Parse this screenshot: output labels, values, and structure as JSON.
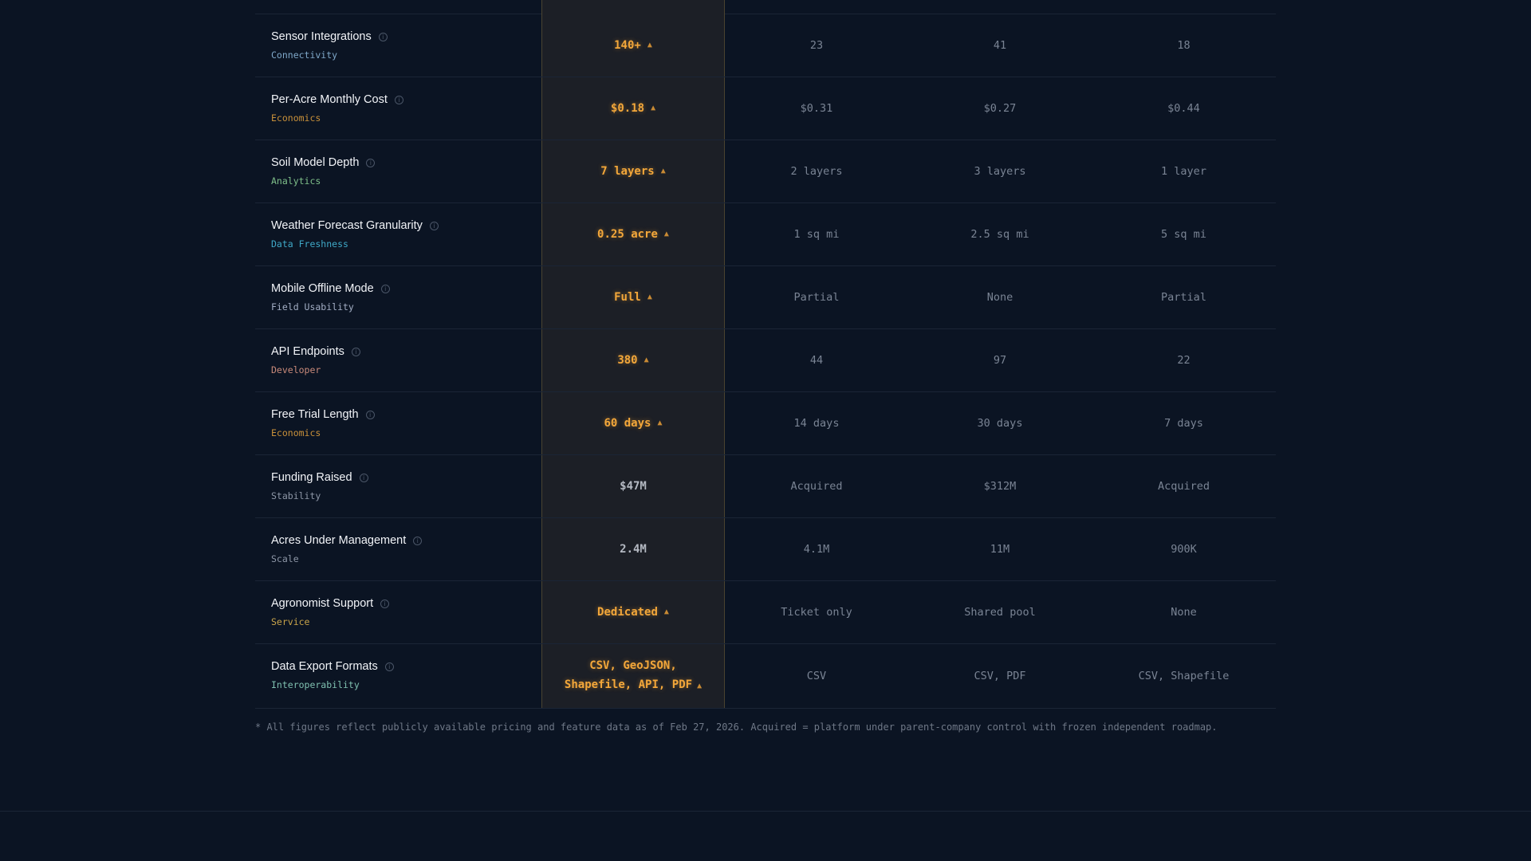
{
  "colors": {
    "background": "#0b1423",
    "highlight_value": "#f3a73a",
    "highlight_column_bg": "#1c1f26",
    "highlight_border": "#4a4330",
    "competitor_text": "#7a8494"
  },
  "rows": [
    {
      "feature": "Sensor Integrations",
      "category": "Connectivity",
      "category_color": "#7fa8c9",
      "highlight": "140+",
      "win": true,
      "c1": "23",
      "c2": "41",
      "c3": "18"
    },
    {
      "feature": "Per-Acre Monthly Cost",
      "category": "Economics",
      "category_color": "#c8903a",
      "highlight": "$0.18",
      "win": true,
      "c1": "$0.31",
      "c2": "$0.27",
      "c3": "$0.44"
    },
    {
      "feature": "Soil Model Depth",
      "category": "Analytics",
      "category_color": "#7fc08a",
      "highlight": "7 layers",
      "win": true,
      "c1": "2 layers",
      "c2": "3 layers",
      "c3": "1 layer"
    },
    {
      "feature": "Weather Forecast Granularity",
      "category": "Data Freshness",
      "category_color": "#3fa9c8",
      "highlight": "0.25 acre",
      "win": true,
      "c1": "1 sq mi",
      "c2": "2.5 sq mi",
      "c3": "5 sq mi"
    },
    {
      "feature": "Mobile Offline Mode",
      "category": "Field Usability",
      "category_color": "#a3aec4",
      "highlight": "Full",
      "win": true,
      "c1": "Partial",
      "c2": "None",
      "c3": "Partial"
    },
    {
      "feature": "API Endpoints",
      "category": "Developer",
      "category_color": "#c98a7a",
      "highlight": "380",
      "win": true,
      "c1": "44",
      "c2": "97",
      "c3": "22"
    },
    {
      "feature": "Free Trial Length",
      "category": "Economics",
      "category_color": "#c8903a",
      "highlight": "60 days",
      "win": true,
      "c1": "14 days",
      "c2": "30 days",
      "c3": "7 days"
    },
    {
      "feature": "Funding Raised",
      "category": "Stability",
      "category_color": "#8d96a6",
      "highlight": "$47M",
      "win": false,
      "c1": "Acquired",
      "c2": "$312M",
      "c3": "Acquired"
    },
    {
      "feature": "Acres Under Management",
      "category": "Scale",
      "category_color": "#8d96a6",
      "highlight": "2.4M",
      "win": false,
      "c1": "4.1M",
      "c2": "11M",
      "c3": "900K"
    },
    {
      "feature": "Agronomist Support",
      "category": "Service",
      "category_color": "#c9a44a",
      "highlight": "Dedicated",
      "win": true,
      "c1": "Ticket only",
      "c2": "Shared pool",
      "c3": "None"
    },
    {
      "feature": "Data Export Formats",
      "category": "Interoperability",
      "category_color": "#7fc0b0",
      "highlight": "CSV, GeoJSON,\nShapefile, API, PDF",
      "win": true,
      "c1": "CSV",
      "c2": "CSV, PDF",
      "c3": "CSV, Shapefile"
    }
  ],
  "advantage_marker": "▲",
  "info_icon_glyph": "i",
  "footnote": "* All figures reflect publicly available pricing and feature data as of Feb 27, 2026. Acquired = platform under parent-company control with frozen independent roadmap."
}
